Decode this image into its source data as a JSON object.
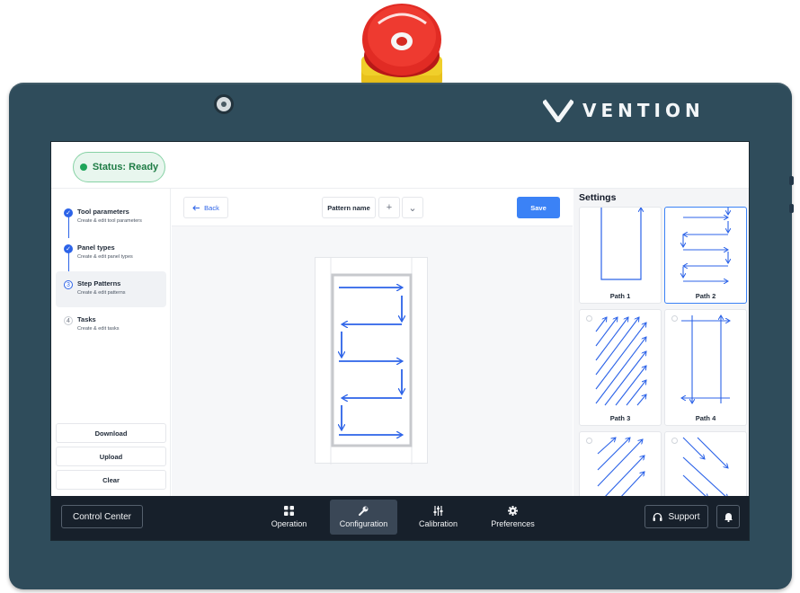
{
  "device": {
    "brand": "VENTION"
  },
  "status": {
    "label": "Status: Ready",
    "color": "#1fa55a"
  },
  "steps": [
    {
      "num": "✓",
      "title": "Tool parameters",
      "subtitle": "Create & edit tool parameters",
      "state": "done"
    },
    {
      "num": "✓",
      "title": "Panel types",
      "subtitle": "Create & edit panel types",
      "state": "done"
    },
    {
      "num": "3",
      "title": "Step Patterns",
      "subtitle": "Create & edit patterns",
      "state": "current"
    },
    {
      "num": "4",
      "title": "Tasks",
      "subtitle": "Create & edit tasks",
      "state": "todo"
    }
  ],
  "rail_actions": {
    "download": "Download",
    "upload": "Upload",
    "clear": "Clear"
  },
  "toolbar": {
    "back": "Back",
    "pattern_name": "Pattern name",
    "add": "+",
    "dropdown": "⌄",
    "save": "Save"
  },
  "settings": {
    "title": "Settings",
    "paths": [
      {
        "label": "Path 1",
        "selected": false
      },
      {
        "label": "Path 2",
        "selected": true
      },
      {
        "label": "Path 3",
        "selected": false
      },
      {
        "label": "Path 4",
        "selected": false
      },
      {
        "label": "",
        "selected": false
      },
      {
        "label": "",
        "selected": false
      }
    ]
  },
  "nav": {
    "control_center": "Control Center",
    "tabs": [
      {
        "label": "Operation",
        "icon": "grid-icon"
      },
      {
        "label": "Configuration",
        "icon": "wrench-icon",
        "active": true
      },
      {
        "label": "Calibration",
        "icon": "sliders-icon"
      },
      {
        "label": "Preferences",
        "icon": "gear-icon"
      }
    ],
    "support": "Support"
  },
  "colors": {
    "accent": "#2c63e8",
    "save": "#3b82f6",
    "bezel": "#2f4c5b",
    "nav": "#17202b"
  }
}
